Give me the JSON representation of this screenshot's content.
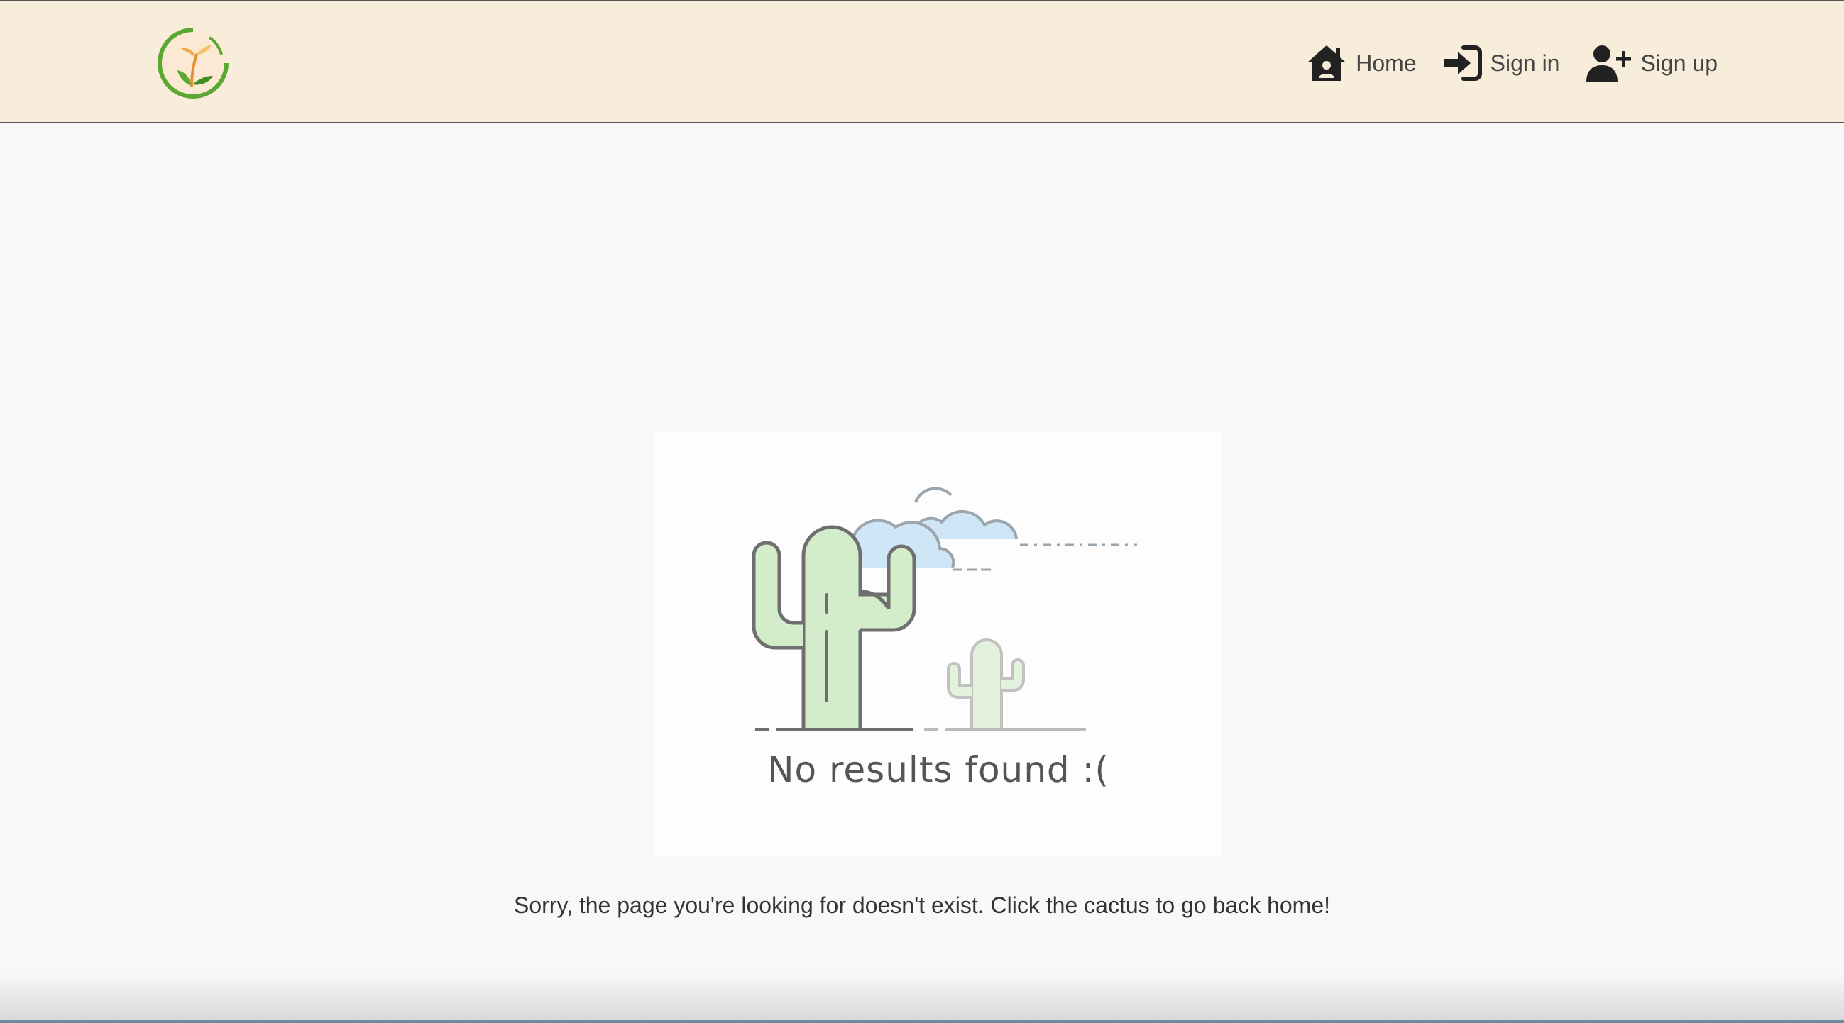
{
  "navbar": {
    "logo_icon": "sprout-logo-icon",
    "links": [
      {
        "label": "Home",
        "icon": "house-user-icon"
      },
      {
        "label": "Sign in",
        "icon": "sign-in-icon"
      },
      {
        "label": "Sign up",
        "icon": "user-plus-icon"
      }
    ]
  },
  "main": {
    "illustration_text": "No results found :(",
    "illustration_icon": "cactus-illustration",
    "message": "Sorry, the page you're looking for doesn't exist. Click the cactus to go back home!"
  },
  "colors": {
    "navbar_bg": "#f8ecdb",
    "page_bg": "#f8f8f8",
    "cactus_green": "#d3ecc9",
    "cloud_blue": "#cfe6f7",
    "logo_green": "#5aa832",
    "logo_orange": "#f0a94a"
  }
}
